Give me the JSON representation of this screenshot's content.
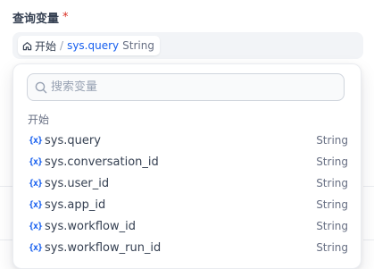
{
  "field": {
    "label": "查询变量",
    "required_mark": "*"
  },
  "selector": {
    "node_name": "开始",
    "separator": "/",
    "variable": "sys.query",
    "type": "String"
  },
  "dropdown": {
    "search_placeholder": "搜索变量",
    "group_title": "开始",
    "variable_icon": "{x}",
    "items": [
      {
        "name": "sys.query",
        "type": "String"
      },
      {
        "name": "sys.conversation_id",
        "type": "String"
      },
      {
        "name": "sys.user_id",
        "type": "String"
      },
      {
        "name": "sys.app_id",
        "type": "String"
      },
      {
        "name": "sys.workflow_id",
        "type": "String"
      },
      {
        "name": "sys.workflow_run_id",
        "type": "String"
      }
    ]
  },
  "colors": {
    "accent": "#155eef",
    "required": "#d92d20",
    "muted": "#676f83"
  }
}
